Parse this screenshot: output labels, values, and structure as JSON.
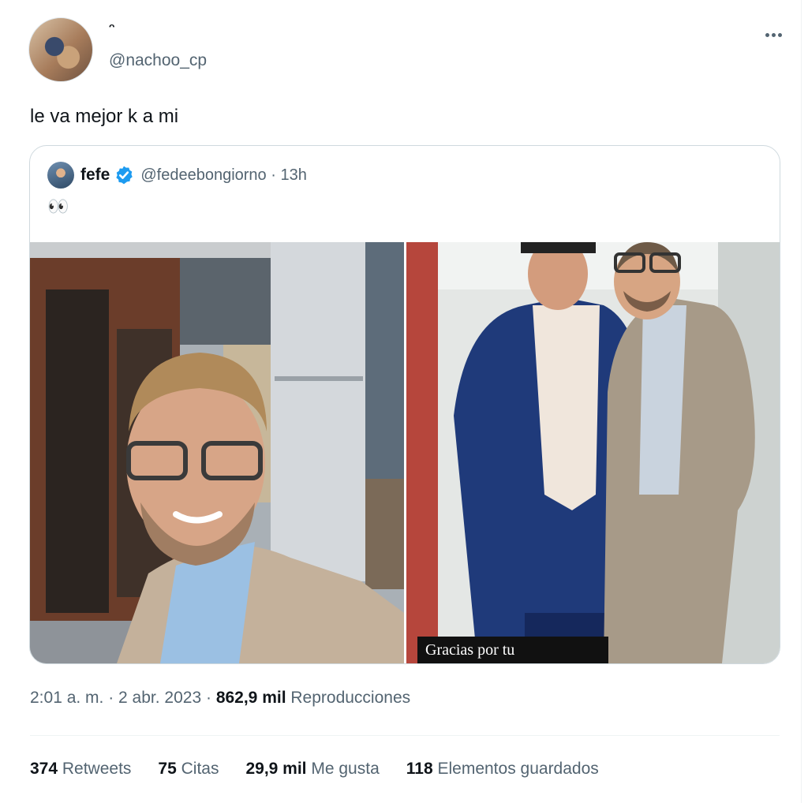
{
  "author": {
    "display_name": "ᵔ",
    "handle": "@nachoo_cp"
  },
  "tweet": {
    "text": "le va mejor k a mi"
  },
  "quoted": {
    "name": "fefe",
    "handle_time": "@fedeebongiorno · 13h",
    "text": "👀",
    "image_caption": "Gracias por tu"
  },
  "meta": {
    "time_date": "2:01 a. m. · 2 abr. 2023 · ",
    "views_count": "862,9 mil",
    "views_label": " Reproducciones"
  },
  "stats": [
    {
      "count": "374",
      "label": " Retweets"
    },
    {
      "count": "75",
      "label": " Citas"
    },
    {
      "count": "29,9 mil",
      "label": " Me gusta"
    },
    {
      "count": "118",
      "label": " Elementos guardados"
    }
  ],
  "colors": {
    "secondary_text": "#536471",
    "primary_text": "#0f1419",
    "verified_blue": "#1d9bf0",
    "border": "#cfd9de"
  },
  "icons": {
    "more": "more-horizontal-icon",
    "verified": "verified-badge-icon"
  }
}
